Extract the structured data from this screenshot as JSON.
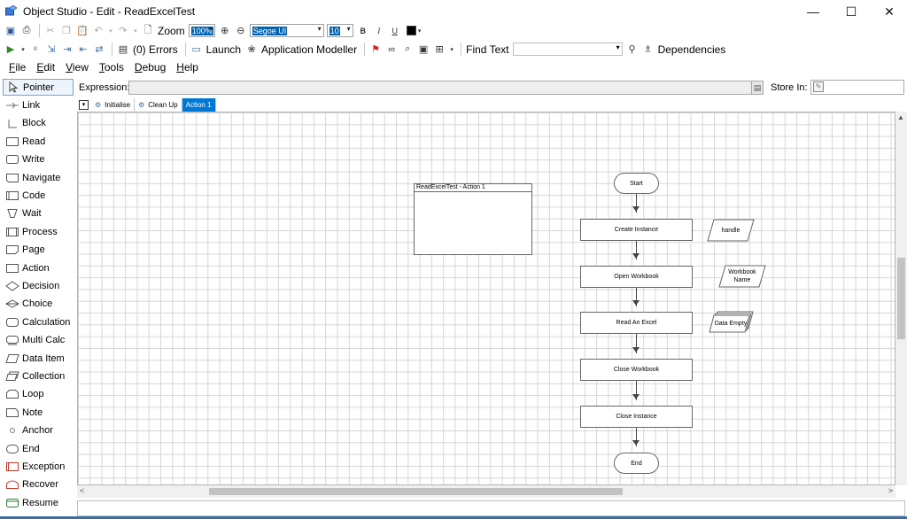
{
  "window": {
    "title": "Object Studio  - Edit - ReadExcelTest",
    "minimize": "—",
    "maximize": "☐",
    "close": "✕"
  },
  "toolbar1": {
    "zoom_label": "Zoom",
    "zoom_value": "100%",
    "font_value": "Segoe UI",
    "size_value": "10",
    "bold": "B",
    "italic": "I",
    "underline": "U"
  },
  "toolbar2": {
    "errors_label": "(0) Errors",
    "launch_label": "Launch",
    "app_modeller_label": "Application Modeller",
    "find_text_label": "Find Text",
    "dependencies_label": "Dependencies"
  },
  "menu": [
    "File",
    "Edit",
    "View",
    "Tools",
    "Debug",
    "Help"
  ],
  "menu_underline": [
    "F",
    "E",
    "V",
    "T",
    "D",
    "H"
  ],
  "palette": [
    {
      "label": "Pointer",
      "icon": "pointer-icon"
    },
    {
      "label": "Link",
      "icon": "link-icon"
    },
    {
      "label": "Block",
      "icon": "block-icon"
    },
    {
      "label": "Read",
      "icon": "read-icon"
    },
    {
      "label": "Write",
      "icon": "write-icon"
    },
    {
      "label": "Navigate",
      "icon": "navigate-icon"
    },
    {
      "label": "Code",
      "icon": "code-icon"
    },
    {
      "label": "Wait",
      "icon": "wait-icon"
    },
    {
      "label": "Process",
      "icon": "process-icon"
    },
    {
      "label": "Page",
      "icon": "page-icon"
    },
    {
      "label": "Action",
      "icon": "action-icon"
    },
    {
      "label": "Decision",
      "icon": "decision-icon"
    },
    {
      "label": "Choice",
      "icon": "choice-icon"
    },
    {
      "label": "Calculation",
      "icon": "calculation-icon"
    },
    {
      "label": "Multi Calc",
      "icon": "multi-calc-icon"
    },
    {
      "label": "Data Item",
      "icon": "data-item-icon"
    },
    {
      "label": "Collection",
      "icon": "collection-icon"
    },
    {
      "label": "Loop",
      "icon": "loop-icon"
    },
    {
      "label": "Note",
      "icon": "note-icon"
    },
    {
      "label": "Anchor",
      "icon": "anchor-icon"
    },
    {
      "label": "End",
      "icon": "end-icon"
    },
    {
      "label": "Exception",
      "icon": "exception-icon"
    },
    {
      "label": "Recover",
      "icon": "recover-icon"
    },
    {
      "label": "Resume",
      "icon": "resume-icon"
    }
  ],
  "expression": {
    "label": "Expression:",
    "value": "",
    "store_label": "Store In:",
    "store_value": ""
  },
  "tabs": [
    {
      "label": "Initialise",
      "active": false
    },
    {
      "label": "Clean Up",
      "active": false
    },
    {
      "label": "Action 1",
      "active": true
    }
  ],
  "flow": {
    "note_title": "ReadExcelTest - Action 1",
    "start": "Start",
    "end": "End",
    "steps": [
      "Create Instance",
      "Open Workbook",
      "Read An Excel",
      "Close Workbook",
      "Close Instance"
    ],
    "data_items": [
      {
        "label": "handle",
        "kind": "data-item"
      },
      {
        "label": "Workbook Name",
        "kind": "data-item"
      },
      {
        "label": "Data Empty",
        "kind": "collection"
      }
    ]
  },
  "colors": {
    "accent": "#0078d7",
    "selection": "#0063b1",
    "grid": "#d6d6d6",
    "exception": "#c0392b",
    "recover": "#c0392b",
    "resume": "#2e7d32"
  }
}
